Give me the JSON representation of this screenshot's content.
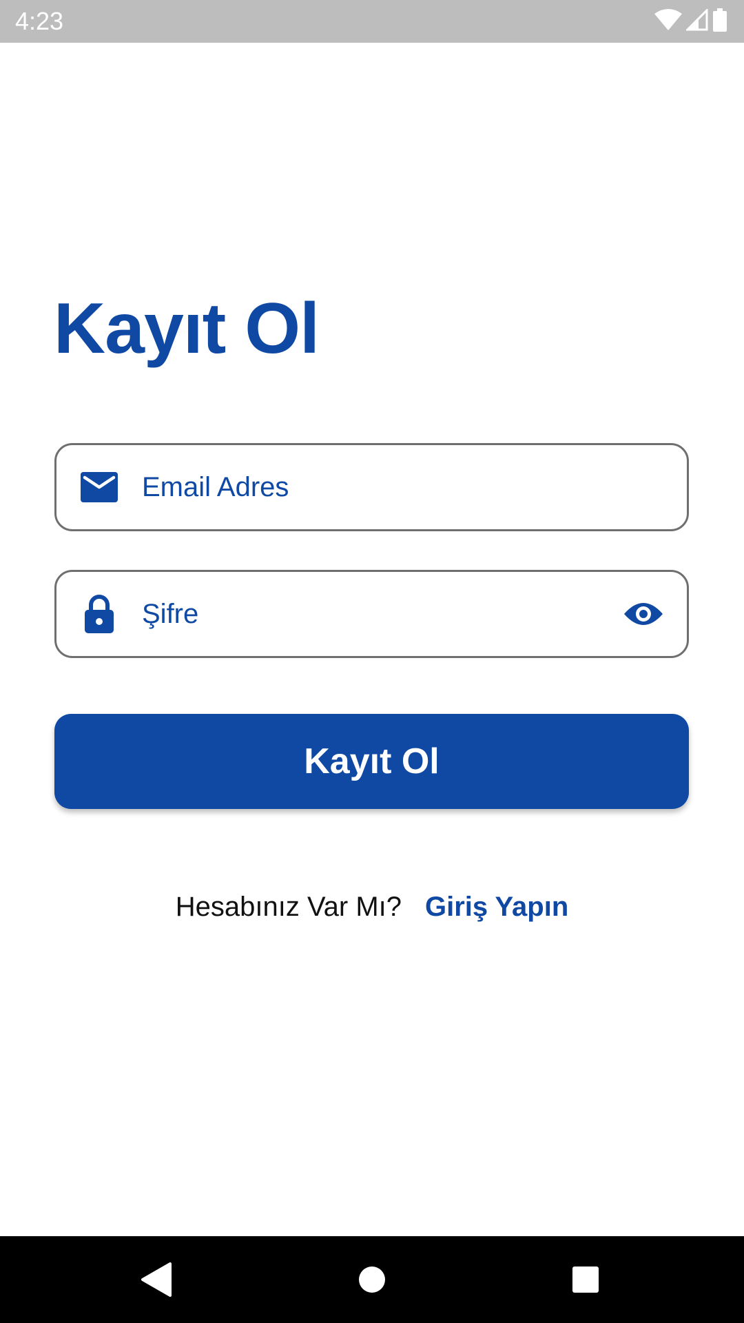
{
  "status_bar": {
    "time": "4:23",
    "icons": [
      "wifi-icon",
      "cell-signal-icon",
      "battery-icon"
    ]
  },
  "screen": {
    "title": "Kayıt Ol"
  },
  "form": {
    "email": {
      "icon": "mail-icon",
      "placeholder": "Email Adres",
      "value": ""
    },
    "password": {
      "icon": "lock-icon",
      "placeholder": "Şifre",
      "value": "",
      "toggle_icon": "eye-icon"
    },
    "submit_label": "Kayıt Ol"
  },
  "footer": {
    "question": "Hesabınız Var Mı?",
    "link": "Giriş Yapın"
  },
  "nav_bar": {
    "buttons": [
      "back-icon",
      "home-icon",
      "recents-icon"
    ]
  },
  "colors": {
    "primary": "#0f49a3",
    "status_bar": "#bdbdbd",
    "nav_bar": "#000000",
    "border": "#6f6f6f"
  }
}
